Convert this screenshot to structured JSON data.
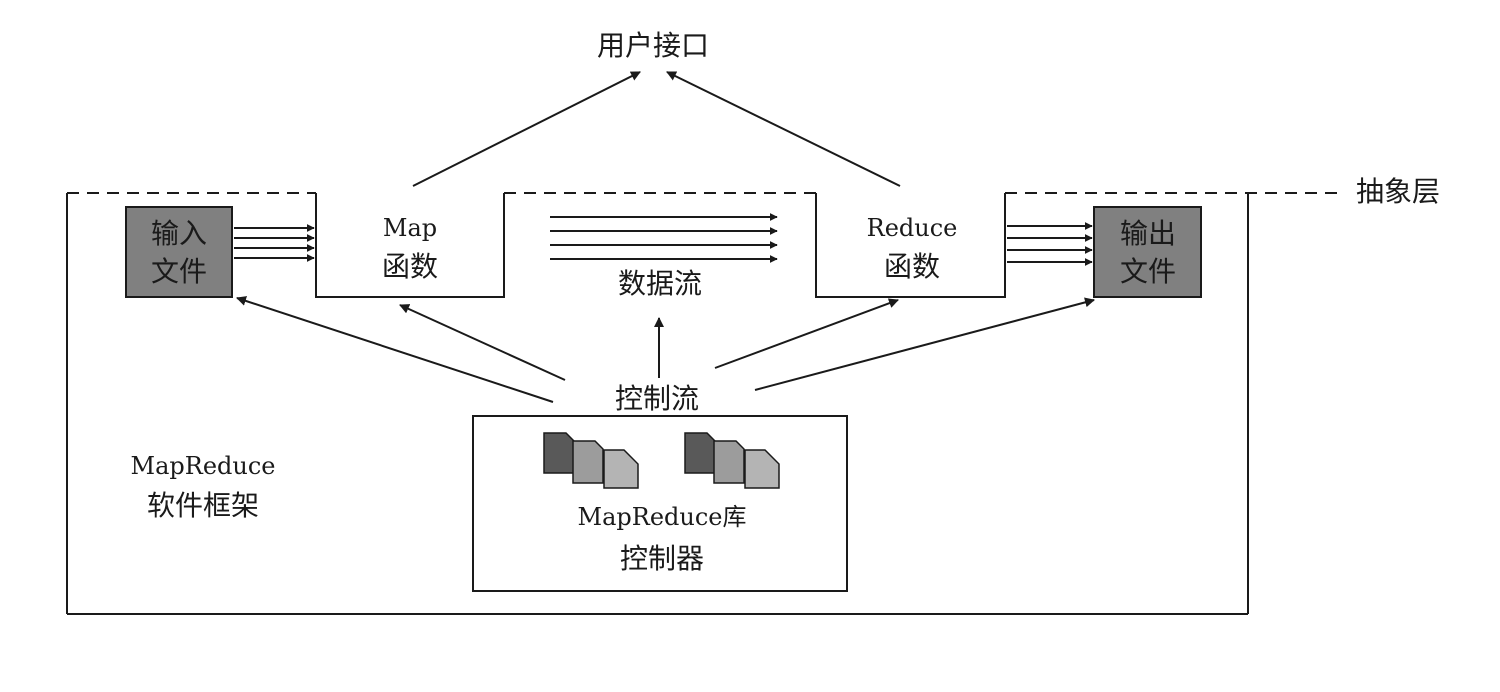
{
  "labels": {
    "user_interface": "用户接口",
    "abstraction_layer": "抽象层",
    "input_file_line1": "输入",
    "input_file_line2": "文件",
    "output_file_line1": "输出",
    "output_file_line2": "文件",
    "map_line1": "Map",
    "map_line2": "函数",
    "reduce_line1": "Reduce",
    "reduce_line2": "函数",
    "data_flow": "数据流",
    "control_flow": "控制流",
    "framework_line1": "MapReduce",
    "framework_line2": "软件框架",
    "library_line1": "MapReduce库",
    "library_line2": "控制器"
  },
  "colors": {
    "file_box_fill": "#808080",
    "doc_dark": "#595959",
    "doc_mid": "#9c9c9c",
    "doc_light": "#b4b4b4",
    "stroke": "#1a1a1a"
  },
  "icons": [
    "document-stack-icon",
    "document-stack-icon"
  ]
}
